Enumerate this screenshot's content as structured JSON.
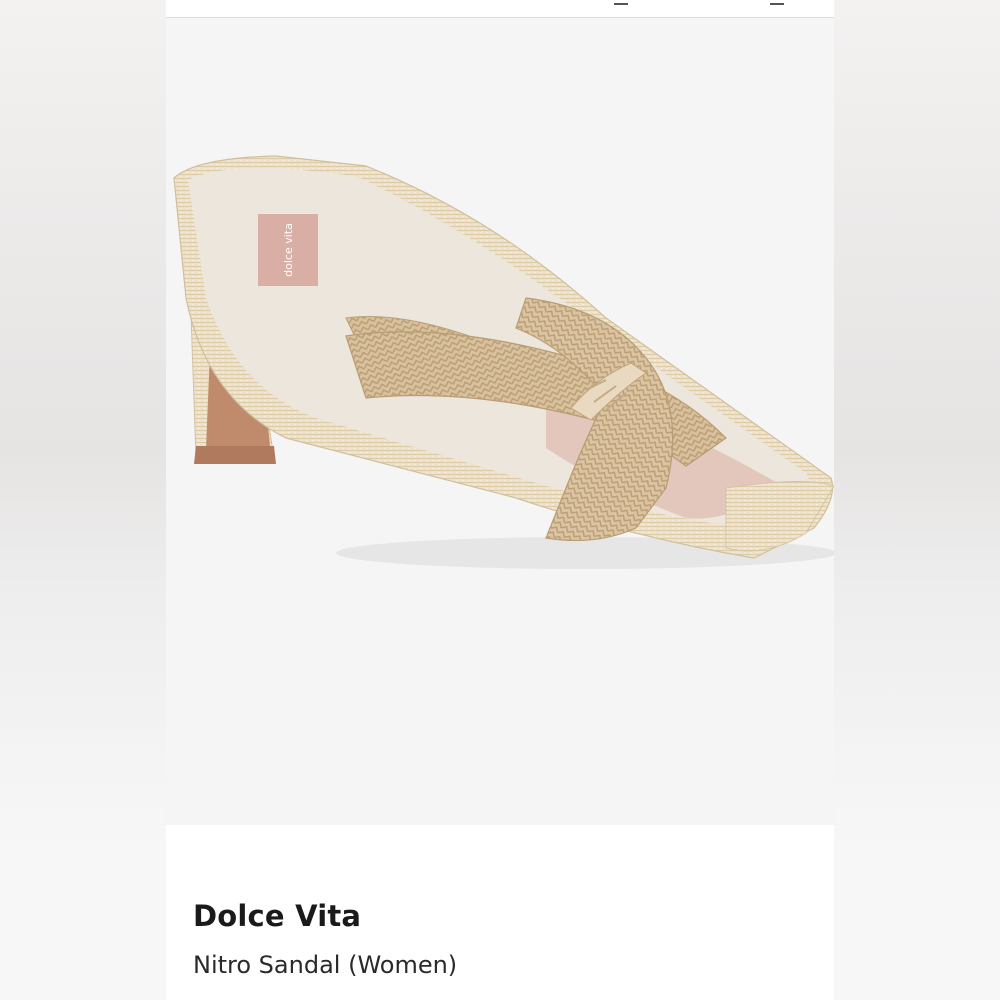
{
  "product": {
    "brand": "Dolce Vita",
    "name": "Nitro Sandal (Women)",
    "insole_logo_text": "dolce vita",
    "image_subject": "sandal-photo"
  },
  "colors": {
    "page_background": "#ffffff",
    "photo_background": "#f5f5f5",
    "raffia": "#e8dcc4",
    "rope_strap": "#d8bf9a",
    "heel_inner": "#b87d62",
    "insole_logo_patch": "#d9aea4",
    "text_primary": "#1a1a1a"
  },
  "topbar": {
    "icons": [
      "share-icon",
      "bag-icon"
    ]
  }
}
